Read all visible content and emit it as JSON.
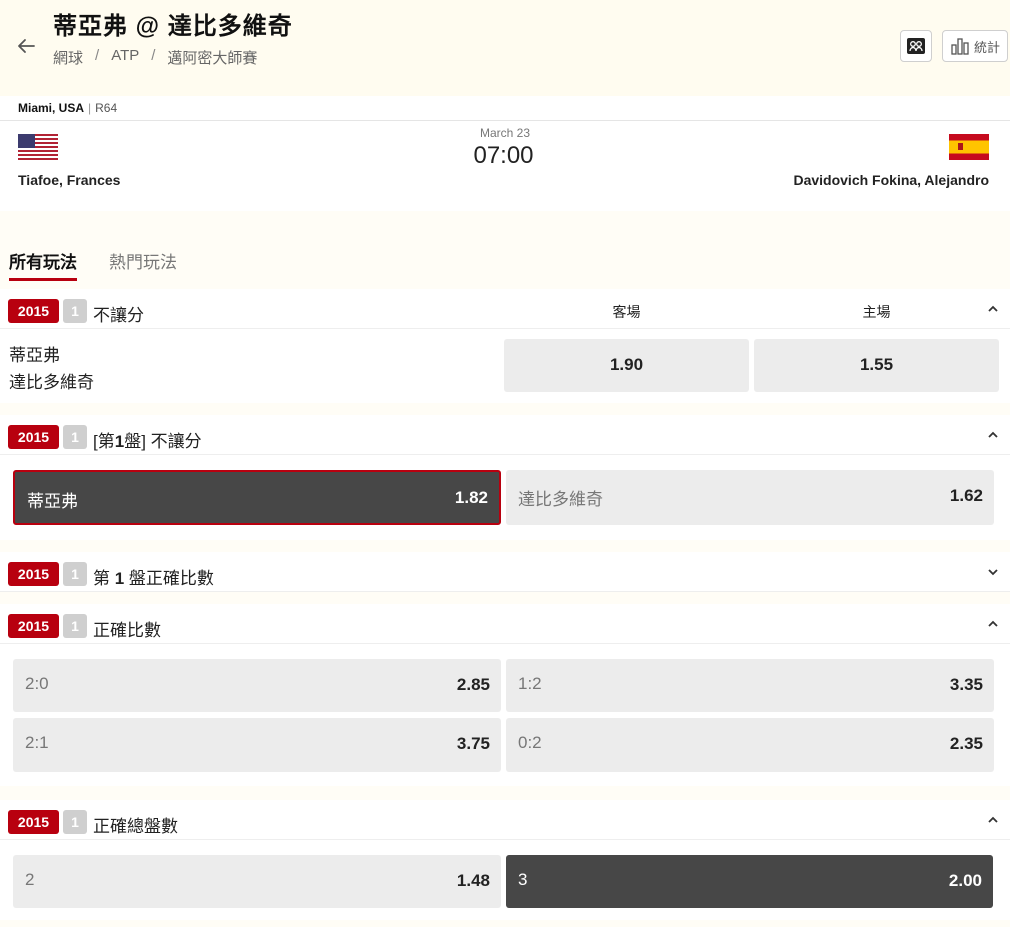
{
  "header": {
    "title": "蒂亞弗 @ 達比多維奇",
    "breadcrumb": [
      "網球",
      "ATP",
      "邁阿密大師賽"
    ],
    "stats_label": "統計"
  },
  "match": {
    "location": "Miami, USA",
    "round": "R64",
    "date": "March 23",
    "time": "07:00",
    "home_player": "Tiafoe, Frances",
    "away_player": "Davidovich Fokina, Alejandro"
  },
  "tabs": [
    "所有玩法",
    "熱門玩法"
  ],
  "markets": {
    "m1": {
      "badge": "2015",
      "count": "1",
      "name": "不讓分",
      "col_away": "客場",
      "col_home": "主場",
      "team1": "蒂亞弗",
      "team2": "達比多維奇",
      "odds": [
        "1.90",
        "1.55"
      ]
    },
    "m2": {
      "badge": "2015",
      "count": "1",
      "name_pre": "[第",
      "name_num": "1",
      "name_post": "盤] 不讓分",
      "options": [
        {
          "label": "蒂亞弗",
          "odds": "1.82"
        },
        {
          "label": "達比多維奇",
          "odds": "1.62"
        }
      ]
    },
    "m3": {
      "badge": "2015",
      "count": "1",
      "name_pre": "第 ",
      "name_num": "1",
      "name_post": " 盤正確比數"
    },
    "m4": {
      "badge": "2015",
      "count": "1",
      "name": "正確比數",
      "options": [
        {
          "label": "2:0",
          "odds": "2.85"
        },
        {
          "label": "1:2",
          "odds": "3.35"
        },
        {
          "label": "2:1",
          "odds": "3.75"
        },
        {
          "label": "0:2",
          "odds": "2.35"
        }
      ]
    },
    "m5": {
      "badge": "2015",
      "count": "1",
      "name": "正確總盤數",
      "options": [
        {
          "label": "2",
          "odds": "1.48"
        },
        {
          "label": "3",
          "odds": "2.00"
        }
      ]
    }
  },
  "colors": {
    "accent": "#b8000f",
    "selected": "#474747",
    "odd_bg": "#ececec"
  },
  "icons": [
    "back-arrow-icon",
    "video-icon",
    "bar-chart-icon",
    "chevron-up-icon",
    "chevron-down-icon",
    "us-flag-icon",
    "spain-flag-icon"
  ]
}
